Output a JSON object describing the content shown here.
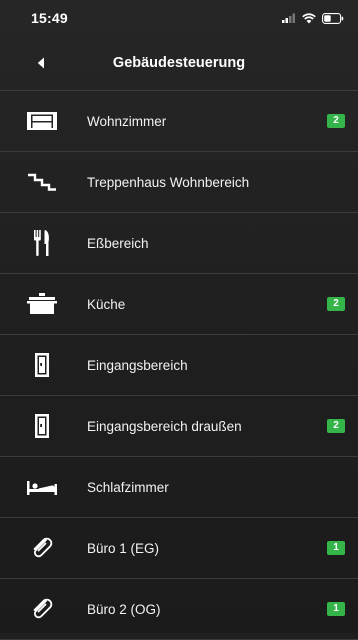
{
  "status_bar": {
    "time": "15:49",
    "icons": [
      "signal-icon",
      "wifi-icon",
      "battery-icon"
    ]
  },
  "nav": {
    "title": "Gebäudesteuerung",
    "back_icon": "back-arrow-icon"
  },
  "colors": {
    "background": "#1f1f1f",
    "divider": "#3b3b3b",
    "badge": "#35b44a",
    "text": "#f2f2f2"
  },
  "rooms": [
    {
      "label": "Wohnzimmer",
      "icon": "sofa-icon",
      "badge": "2"
    },
    {
      "label": "Treppenhaus Wohnbereich",
      "icon": "stairs-icon",
      "badge": ""
    },
    {
      "label": "Eßbereich",
      "icon": "cutlery-icon",
      "badge": ""
    },
    {
      "label": "Küche",
      "icon": "cooking-pot-icon",
      "badge": "2"
    },
    {
      "label": "Eingangsbereich",
      "icon": "door-icon",
      "badge": ""
    },
    {
      "label": "Eingangsbereich draußen",
      "icon": "door-icon",
      "badge": "2"
    },
    {
      "label": "Schlafzimmer",
      "icon": "bed-icon",
      "badge": ""
    },
    {
      "label": "Büro 1 (EG)",
      "icon": "paperclip-icon",
      "badge": "1"
    },
    {
      "label": "Büro 2 (OG)",
      "icon": "paperclip-icon",
      "badge": "1"
    }
  ]
}
